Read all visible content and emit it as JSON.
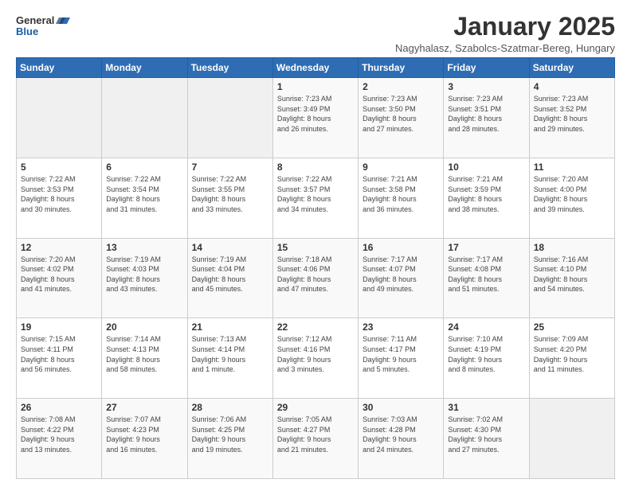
{
  "header": {
    "logo_general": "General",
    "logo_blue": "Blue",
    "title": "January 2025",
    "location": "Nagyhalasz, Szabolcs-Szatmar-Bereg, Hungary"
  },
  "weekdays": [
    "Sunday",
    "Monday",
    "Tuesday",
    "Wednesday",
    "Thursday",
    "Friday",
    "Saturday"
  ],
  "weeks": [
    [
      {
        "day": "",
        "info": ""
      },
      {
        "day": "",
        "info": ""
      },
      {
        "day": "",
        "info": ""
      },
      {
        "day": "1",
        "info": "Sunrise: 7:23 AM\nSunset: 3:49 PM\nDaylight: 8 hours\nand 26 minutes."
      },
      {
        "day": "2",
        "info": "Sunrise: 7:23 AM\nSunset: 3:50 PM\nDaylight: 8 hours\nand 27 minutes."
      },
      {
        "day": "3",
        "info": "Sunrise: 7:23 AM\nSunset: 3:51 PM\nDaylight: 8 hours\nand 28 minutes."
      },
      {
        "day": "4",
        "info": "Sunrise: 7:23 AM\nSunset: 3:52 PM\nDaylight: 8 hours\nand 29 minutes."
      }
    ],
    [
      {
        "day": "5",
        "info": "Sunrise: 7:22 AM\nSunset: 3:53 PM\nDaylight: 8 hours\nand 30 minutes."
      },
      {
        "day": "6",
        "info": "Sunrise: 7:22 AM\nSunset: 3:54 PM\nDaylight: 8 hours\nand 31 minutes."
      },
      {
        "day": "7",
        "info": "Sunrise: 7:22 AM\nSunset: 3:55 PM\nDaylight: 8 hours\nand 33 minutes."
      },
      {
        "day": "8",
        "info": "Sunrise: 7:22 AM\nSunset: 3:57 PM\nDaylight: 8 hours\nand 34 minutes."
      },
      {
        "day": "9",
        "info": "Sunrise: 7:21 AM\nSunset: 3:58 PM\nDaylight: 8 hours\nand 36 minutes."
      },
      {
        "day": "10",
        "info": "Sunrise: 7:21 AM\nSunset: 3:59 PM\nDaylight: 8 hours\nand 38 minutes."
      },
      {
        "day": "11",
        "info": "Sunrise: 7:20 AM\nSunset: 4:00 PM\nDaylight: 8 hours\nand 39 minutes."
      }
    ],
    [
      {
        "day": "12",
        "info": "Sunrise: 7:20 AM\nSunset: 4:02 PM\nDaylight: 8 hours\nand 41 minutes."
      },
      {
        "day": "13",
        "info": "Sunrise: 7:19 AM\nSunset: 4:03 PM\nDaylight: 8 hours\nand 43 minutes."
      },
      {
        "day": "14",
        "info": "Sunrise: 7:19 AM\nSunset: 4:04 PM\nDaylight: 8 hours\nand 45 minutes."
      },
      {
        "day": "15",
        "info": "Sunrise: 7:18 AM\nSunset: 4:06 PM\nDaylight: 8 hours\nand 47 minutes."
      },
      {
        "day": "16",
        "info": "Sunrise: 7:17 AM\nSunset: 4:07 PM\nDaylight: 8 hours\nand 49 minutes."
      },
      {
        "day": "17",
        "info": "Sunrise: 7:17 AM\nSunset: 4:08 PM\nDaylight: 8 hours\nand 51 minutes."
      },
      {
        "day": "18",
        "info": "Sunrise: 7:16 AM\nSunset: 4:10 PM\nDaylight: 8 hours\nand 54 minutes."
      }
    ],
    [
      {
        "day": "19",
        "info": "Sunrise: 7:15 AM\nSunset: 4:11 PM\nDaylight: 8 hours\nand 56 minutes."
      },
      {
        "day": "20",
        "info": "Sunrise: 7:14 AM\nSunset: 4:13 PM\nDaylight: 8 hours\nand 58 minutes."
      },
      {
        "day": "21",
        "info": "Sunrise: 7:13 AM\nSunset: 4:14 PM\nDaylight: 9 hours\nand 1 minute."
      },
      {
        "day": "22",
        "info": "Sunrise: 7:12 AM\nSunset: 4:16 PM\nDaylight: 9 hours\nand 3 minutes."
      },
      {
        "day": "23",
        "info": "Sunrise: 7:11 AM\nSunset: 4:17 PM\nDaylight: 9 hours\nand 5 minutes."
      },
      {
        "day": "24",
        "info": "Sunrise: 7:10 AM\nSunset: 4:19 PM\nDaylight: 9 hours\nand 8 minutes."
      },
      {
        "day": "25",
        "info": "Sunrise: 7:09 AM\nSunset: 4:20 PM\nDaylight: 9 hours\nand 11 minutes."
      }
    ],
    [
      {
        "day": "26",
        "info": "Sunrise: 7:08 AM\nSunset: 4:22 PM\nDaylight: 9 hours\nand 13 minutes."
      },
      {
        "day": "27",
        "info": "Sunrise: 7:07 AM\nSunset: 4:23 PM\nDaylight: 9 hours\nand 16 minutes."
      },
      {
        "day": "28",
        "info": "Sunrise: 7:06 AM\nSunset: 4:25 PM\nDaylight: 9 hours\nand 19 minutes."
      },
      {
        "day": "29",
        "info": "Sunrise: 7:05 AM\nSunset: 4:27 PM\nDaylight: 9 hours\nand 21 minutes."
      },
      {
        "day": "30",
        "info": "Sunrise: 7:03 AM\nSunset: 4:28 PM\nDaylight: 9 hours\nand 24 minutes."
      },
      {
        "day": "31",
        "info": "Sunrise: 7:02 AM\nSunset: 4:30 PM\nDaylight: 9 hours\nand 27 minutes."
      },
      {
        "day": "",
        "info": ""
      }
    ]
  ]
}
